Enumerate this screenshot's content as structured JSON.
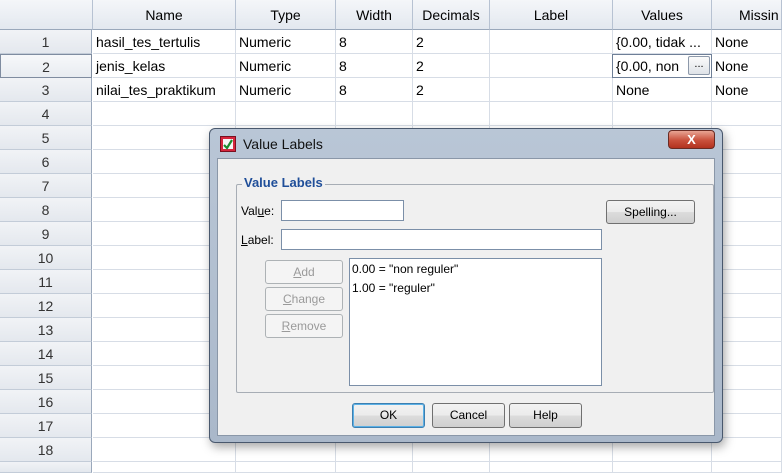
{
  "columns": [
    "Name",
    "Type",
    "Width",
    "Decimals",
    "Label",
    "Values",
    "Missin"
  ],
  "row_numbers": [
    "1",
    "2",
    "3",
    "4",
    "5",
    "6",
    "7",
    "8",
    "9",
    "10",
    "11",
    "12",
    "13",
    "14",
    "15",
    "16",
    "17",
    "18"
  ],
  "rows": [
    {
      "name": "hasil_tes_tertulis",
      "type": "Numeric",
      "width": "8",
      "decimals": "2",
      "label": "",
      "values": "{0.00, tidak ...",
      "missing": "None"
    },
    {
      "name": "jenis_kelas",
      "type": "Numeric",
      "width": "8",
      "decimals": "2",
      "label": "",
      "values": "{0.00, non",
      "missing": "None"
    },
    {
      "name": "nilai_tes_praktikum",
      "type": "Numeric",
      "width": "8",
      "decimals": "2",
      "label": "",
      "values": "None",
      "missing": "None"
    }
  ],
  "ellipsis_button": "...",
  "dialog": {
    "title": "Value Labels",
    "close_glyph": "X",
    "group_title": "Value Labels",
    "value_label_pre": "Val",
    "value_label_u": "u",
    "value_label_post": "e:",
    "label_label_u": "L",
    "label_label_post": "abel:",
    "value_input": "",
    "label_input": "",
    "spelling_button": "Spelling...",
    "add_button_u": "A",
    "add_button_post": "dd",
    "change_button_u": "C",
    "change_button_post": "hange",
    "remove_button_u": "R",
    "remove_button_post": "emove",
    "label_list": [
      "0.00 = \"non reguler\"",
      "1.00 = \"reguler\""
    ],
    "ok_button": "OK",
    "cancel_button": "Cancel",
    "help_button": "Help"
  },
  "colors": {
    "accent": "#1f4e99",
    "close_red": "#c9503c",
    "frame": "#aab8ca"
  }
}
